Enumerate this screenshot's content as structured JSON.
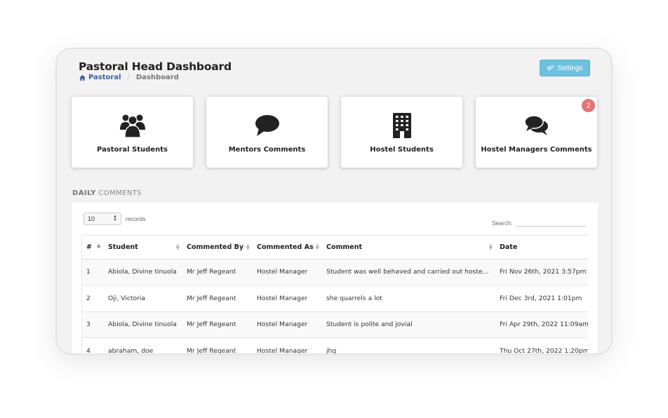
{
  "header": {
    "title": "Pastoral Head Dashboard",
    "breadcrumb_home": "Pastoral",
    "breadcrumb_current": "Dashboard",
    "settings_label": "Settings"
  },
  "cards": [
    {
      "label": "Pastoral Students",
      "icon": "users-icon"
    },
    {
      "label": "Mentors Comments",
      "icon": "comment-icon"
    },
    {
      "label": "Hostel Students",
      "icon": "building-icon"
    },
    {
      "label": "Hostel Managers Comments",
      "icon": "comments-icon",
      "badge": "2"
    }
  ],
  "section": {
    "title_bold": "DAILY",
    "title_rest": "COMMENTS"
  },
  "table_controls": {
    "page_length": "10",
    "records_label": "records",
    "search_label": "Search:"
  },
  "table": {
    "columns": [
      "#",
      "Student",
      "Commented By",
      "Commented As",
      "Comment",
      "Date"
    ],
    "rows": [
      [
        "1",
        "Abiola, Divine tinuola",
        "Mr Jeff Regeant",
        "Hostel Manager",
        "Student was well behaved and carried out hoste...",
        "Fri Nov 26th, 2021 3:57pm"
      ],
      [
        "2",
        "Oji, Victoria",
        "Mr Jeff Regeant",
        "Hostel Manager",
        "she quarrels a lot",
        "Fri Dec 3rd, 2021 1:01pm"
      ],
      [
        "3",
        "Abiola, Divine tinuola",
        "Mr Jeff Regeant",
        "Hostel Manager",
        "Student is polite and jovial",
        "Fri Apr 29th, 2022 11:09am"
      ],
      [
        "4",
        "abraham, doe",
        "Mr Jeff Regeant",
        "Hostel Manager",
        "jhg",
        "Thu Oct 27th, 2022 1:20pm"
      ]
    ]
  },
  "colors": {
    "settings_button": "#6dc1df",
    "badge": "#e57373",
    "breadcrumb_link": "#3c5f9e"
  }
}
